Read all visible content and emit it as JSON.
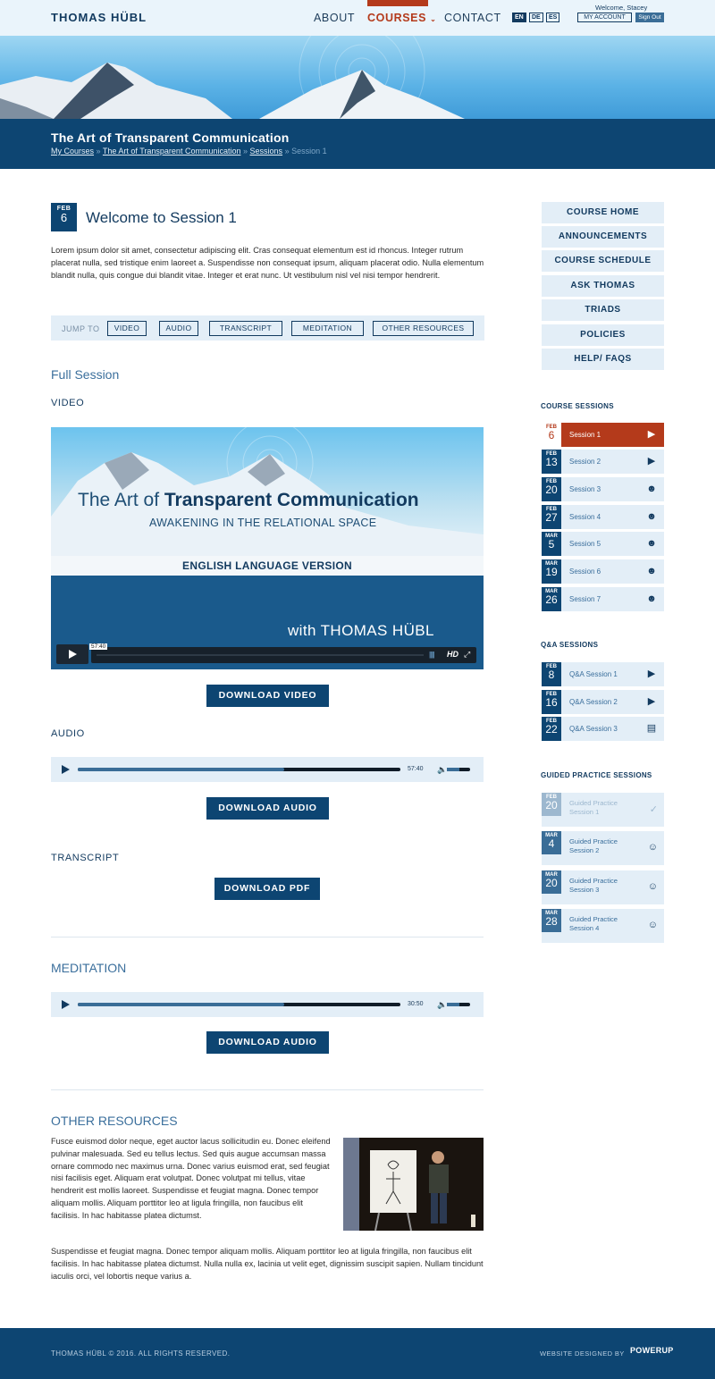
{
  "header": {
    "logo": "THOMAS HÜBL",
    "nav": [
      "ABOUT",
      "COURSES",
      "CONTACT"
    ],
    "languages": [
      "EN",
      "DE",
      "ES"
    ],
    "welcome": "Welcome, Stacey",
    "my_account": "MY ACCOUNT",
    "sign_out": "Sign Out"
  },
  "title_bar": {
    "title": "The Art of Transparent Communication",
    "breadcrumbs": [
      "My Courses",
      "The Art of Transparent Communication",
      "Sessions",
      "Session 1"
    ],
    "separator": "»"
  },
  "session": {
    "month": "FEB",
    "day": "6",
    "heading": "Welcome to Session 1",
    "intro": "Lorem ipsum dolor sit amet, consectetur adipiscing elit. Cras consequat elementum est id rhoncus. Integer rutrum placerat nulla, sed tristique enim laoreet a. Suspendisse non consequat ipsum, aliquam placerat odio. Nulla elementum blandit nulla, quis congue dui blandit vitae. Integer et erat nunc. Ut vestibulum nisl vel nisi tempor hendrerit."
  },
  "jump": {
    "label": "JUMP TO",
    "links": [
      "VIDEO",
      "AUDIO",
      "TRANSCRIPT",
      "MEDITATION",
      "OTHER RESOURCES"
    ]
  },
  "full_session": {
    "title": "Full Session",
    "video_label": "VIDEO",
    "video_title_plain": "The Art of",
    "video_title_bold": "Transparent Communication",
    "video_subtitle": "AWAKENING IN THE RELATIONAL SPACE",
    "video_band": "ENGLISH LANGUAGE VERSION",
    "video_with": "with THOMAS HÜBL",
    "video_time": "57:40",
    "video_hd": "HD",
    "download_video": "DOWNLOAD VIDEO",
    "audio_label": "AUDIO",
    "audio_time": "57:40",
    "audio_progress": 0.64,
    "download_audio": "DOWNLOAD AUDIO",
    "transcript_label": "TRANSCRIPT",
    "download_pdf": "DOWNLOAD PDF"
  },
  "meditation": {
    "title": "MEDITATION",
    "audio_time": "30:50",
    "audio_progress": 0.64,
    "download_audio": "DOWNLOAD AUDIO"
  },
  "other_resources": {
    "title": "OTHER RESOURCES",
    "para1": "Fusce euismod dolor neque, eget auctor lacus sollicitudin eu. Donec eleifend pulvinar malesuada. Sed eu tellus lectus. Sed quis augue accumsan massa ornare commodo nec maximus urna. Donec varius euismod erat, sed feugiat nisi facilisis eget. Aliquam erat volutpat. Donec volutpat mi tellus, vitae hendrerit est mollis laoreet. Suspendisse et feugiat magna. Donec tempor aliquam mollis. Aliquam porttitor leo at ligula fringilla, non faucibus elit facilisis. In hac habitasse platea dictumst.",
    "para2": "Suspendisse et feugiat magna. Donec tempor aliquam mollis. Aliquam porttitor leo at ligula fringilla, non faucibus elit facilisis. In hac habitasse platea dictumst. Nulla nulla ex, lacinia ut velit eget, dignissim suscipit sapien. Nullam tincidunt iaculis orci, vel lobortis neque varius a."
  },
  "sidebar": {
    "menu": [
      "COURSE HOME",
      "ANNOUNCEMENTS",
      "COURSE SCHEDULE",
      "ASK THOMAS",
      "TRIADS",
      "POLICIES",
      "HELP/ FAQS"
    ],
    "course_sessions_title": "COURSE SESSIONS",
    "course_sessions": [
      {
        "month": "FEB",
        "day": "6",
        "label": "Session 1",
        "icon": "video-icon"
      },
      {
        "month": "FEB",
        "day": "13",
        "label": "Session 2",
        "icon": "video-icon"
      },
      {
        "month": "FEB",
        "day": "20",
        "label": "Session 3",
        "icon": "group-icon"
      },
      {
        "month": "FEB",
        "day": "27",
        "label": "Session 4",
        "icon": "group-icon"
      },
      {
        "month": "MAR",
        "day": "5",
        "label": "Session 5",
        "icon": "group-icon"
      },
      {
        "month": "MAR",
        "day": "19",
        "label": "Session 6",
        "icon": "group-icon"
      },
      {
        "month": "MAR",
        "day": "26",
        "label": "Session 7",
        "icon": "group-icon"
      }
    ],
    "qa_sessions_title": "Q&A SESSIONS",
    "qa_sessions": [
      {
        "month": "FEB",
        "day": "8",
        "label": "Q&A Session 1",
        "icon": "video-icon"
      },
      {
        "month": "FEB",
        "day": "16",
        "label": "Q&A Session 2",
        "icon": "video-icon"
      },
      {
        "month": "FEB",
        "day": "22",
        "label": "Q&A Session 3",
        "icon": "document-icon"
      }
    ],
    "guided_title": "GUIDED PRACTICE SESSIONS",
    "guided_sessions": [
      {
        "month": "FEB",
        "day": "20",
        "line1": "Guided Practice",
        "line2": "Session 1",
        "icon": "check-icon"
      },
      {
        "month": "MAR",
        "day": "4",
        "line1": "Guided Practice",
        "line2": "Session 2",
        "icon": "meditation-icon"
      },
      {
        "month": "MAR",
        "day": "20",
        "line1": "Guided Practice",
        "line2": "Session 3",
        "icon": "meditation-icon"
      },
      {
        "month": "MAR",
        "day": "28",
        "line1": "Guided Practice",
        "line2": "Session 4",
        "icon": "meditation-icon"
      }
    ]
  },
  "footer": {
    "copyright": "THOMAS HÜBL © 2016. ALL RIGHTS RESERVED.",
    "designed_by": "WEBSITE DESIGNED BY",
    "brand": "POWERUP"
  },
  "colors": {
    "navy": "#0d4572",
    "accent": "#b43a1b",
    "light": "#e3eef7"
  }
}
